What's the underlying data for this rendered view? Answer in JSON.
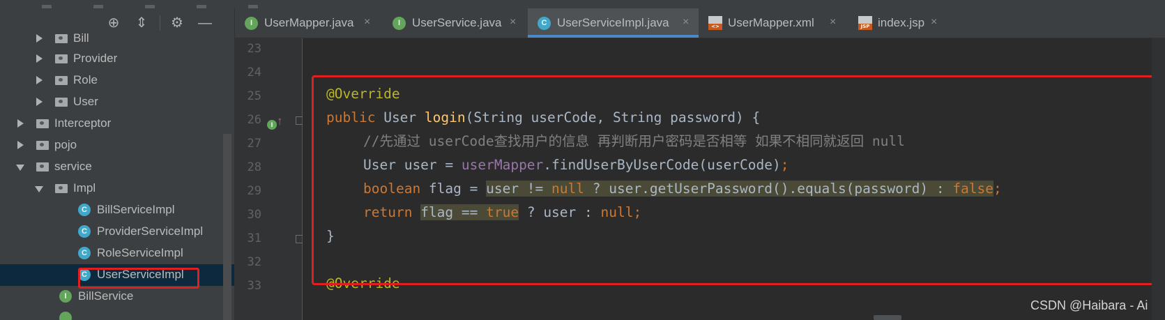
{
  "project_panel": {
    "toolbar_icons": [
      "crosshair-icon",
      "collapse-icon",
      "gear-icon",
      "minimize-icon"
    ],
    "tree": [
      {
        "label": "Bill",
        "kind": "folder",
        "state": "collapsed"
      },
      {
        "label": "Provider",
        "kind": "folder",
        "state": "collapsed"
      },
      {
        "label": "Role",
        "kind": "folder",
        "state": "collapsed"
      },
      {
        "label": "User",
        "kind": "folder",
        "state": "collapsed"
      },
      {
        "label": "Interceptor",
        "kind": "folder",
        "state": "collapsed"
      },
      {
        "label": "pojo",
        "kind": "folder",
        "state": "collapsed"
      },
      {
        "label": "service",
        "kind": "folder",
        "state": "expanded"
      },
      {
        "label": "Impl",
        "kind": "folder",
        "state": "expanded"
      },
      {
        "label": "BillServiceImpl",
        "kind": "class",
        "icon_letter": "C"
      },
      {
        "label": "ProviderServiceImpl",
        "kind": "class",
        "icon_letter": "C"
      },
      {
        "label": "RoleServiceImpl",
        "kind": "class",
        "icon_letter": "C"
      },
      {
        "label": "UserServiceImpl",
        "kind": "class",
        "icon_letter": "C",
        "selected": true
      },
      {
        "label": "BillService",
        "kind": "interface",
        "icon_letter": "I"
      }
    ]
  },
  "tabs": [
    {
      "label": "UserMapper.java",
      "icon": "interface-icon",
      "icon_letter": "I"
    },
    {
      "label": "UserService.java",
      "icon": "interface-icon",
      "icon_letter": "I"
    },
    {
      "label": "UserServiceImpl.java",
      "icon": "class-icon",
      "icon_letter": "C",
      "active": true
    },
    {
      "label": "UserMapper.xml",
      "icon": "xml-file-icon",
      "badge": "<>"
    },
    {
      "label": "index.jsp",
      "icon": "jsp-file-icon",
      "badge": "JSP"
    }
  ],
  "close_glyph": "×",
  "editor": {
    "line_numbers": [
      "23",
      "24",
      "25",
      "26",
      "27",
      "28",
      "29",
      "30",
      "31",
      "32",
      "33"
    ],
    "code": {
      "l25_annotation": "@Override",
      "l26_public": "public",
      "l26_type": "User",
      "l26_method": "login",
      "l26_params": "(String userCode, String password) {",
      "l27_comment": "//先通过 userCode查找用户的信息 再判断用户密码是否相等 如果不相同就返回 null",
      "l28_decl": "User user = ",
      "l28_field": "userMapper",
      "l28_call": ".findUserByUserCode(userCode)",
      "l28_semi": ";",
      "l29_kw": "boolean",
      "l29_decl": " flag = ",
      "l29_hl_a": "user != ",
      "l29_null": "null",
      "l29_hl_b": " ? user.getUserPassword().equals(password) : ",
      "l29_false": "false",
      "l29_semi": ";",
      "l30_return": "return",
      "l30_hl": "flag == ",
      "l30_true": "true",
      "l30_rest": " ? user : ",
      "l30_null": "null",
      "l30_semi": ";",
      "l31_brace": "}",
      "l33_annotation": "@Override"
    }
  },
  "watermark": "CSDN @Haibara - Ai",
  "colors": {
    "keyword": "#cc7832",
    "annotation": "#bbb529",
    "method": "#ffc66d",
    "field": "#9876aa",
    "comment": "#808080",
    "highlight_box": "#e02020"
  }
}
